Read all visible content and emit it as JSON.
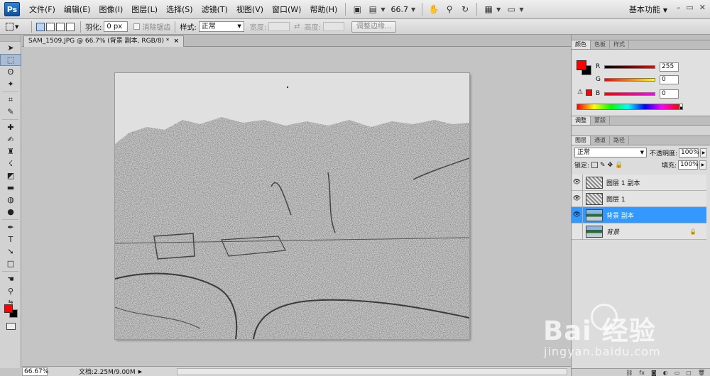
{
  "menubar": {
    "app_logo": "Ps",
    "items": [
      "文件(F)",
      "编辑(E)",
      "图像(I)",
      "图层(L)",
      "选择(S)",
      "滤镜(T)",
      "视图(V)",
      "窗口(W)",
      "帮助(H)"
    ],
    "zoom": "66.7",
    "workspace": "基本功能"
  },
  "options": {
    "feather_label": "羽化:",
    "feather_value": "0 px",
    "antialias_label": "消除锯齿",
    "style_label": "样式:",
    "style_value": "正常",
    "width_label": "宽度:",
    "height_label": "高度:",
    "refine_label": "调整边缘..."
  },
  "document": {
    "tab_title": "SAM_1509.JPG @ 66.7% (背景 副本, RGB/8) *",
    "close_glyph": "×"
  },
  "status": {
    "zoom": "66.67%",
    "doc_info": "文档:2.25M/9.00M",
    "arrow": "▶"
  },
  "color_panel": {
    "tabs": [
      "颜色",
      "色板",
      "样式"
    ],
    "channels": [
      {
        "label": "R",
        "value": "255"
      },
      {
        "label": "G",
        "value": "0"
      },
      {
        "label": "B",
        "value": "0"
      }
    ],
    "colors": {
      "foreground": "#ff0000",
      "background": "#000000"
    }
  },
  "adjust_panel": {
    "tabs": [
      "调整",
      "蒙版"
    ]
  },
  "layers_panel": {
    "tabs": [
      "图层",
      "通道",
      "路径"
    ],
    "blend_mode": "正常",
    "opacity_label": "不透明度:",
    "opacity_value": "100%",
    "lock_label": "锁定:",
    "fill_label": "填充:",
    "fill_value": "100%",
    "layers": [
      {
        "name": "图层 1 副本",
        "visible": true,
        "selected": false,
        "thumb": "sketch"
      },
      {
        "name": "图层 1",
        "visible": true,
        "selected": false,
        "thumb": "sketch"
      },
      {
        "name": "背景 副本",
        "visible": true,
        "selected": true,
        "thumb": "photo"
      },
      {
        "name": "背景",
        "visible": false,
        "selected": false,
        "thumb": "photo",
        "locked": true
      }
    ]
  },
  "watermark": {
    "main": "Bai 经验",
    "sub": "jingyan.baidu.com"
  }
}
